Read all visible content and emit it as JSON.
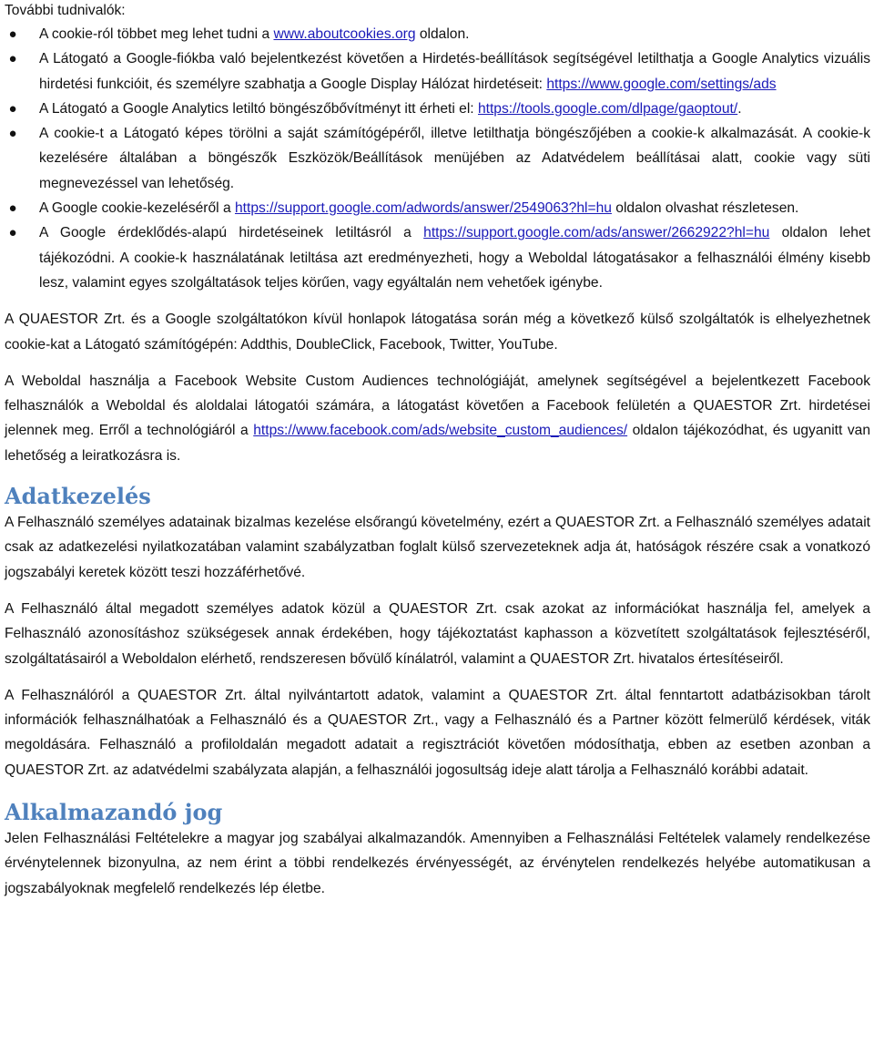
{
  "intro_label": "További tudnivalók:",
  "bullets": [
    {
      "pre": "A cookie-ról többet meg lehet tudni a ",
      "link": "www.aboutcookies.org",
      "post": " oldalon."
    },
    {
      "pre": "A Látogató a Google-fiókba való bejelentkezést követően a Hirdetés-beállítások segítségével letilthatja a Google Analytics vizuális hirdetési funkcióit, és személyre szabhatja a Google Display Hálózat hirdetéseit: ",
      "link": "https://www.google.com/settings/ads",
      "post": ""
    },
    {
      "pre": "A Látogató a Google Analytics letiltó böngészőbővítményt itt érheti el: ",
      "link": "https://tools.google.com/dlpage/gaoptout/",
      "post": "."
    },
    {
      "pre": "A cookie-t a Látogató képes törölni a saját számítógépéről, illetve letilthatja böngészőjében a cookie-k alkalmazását. A cookie-k kezelésére általában a böngészők Eszközök/Beállítások menüjében az Adatvédelem beállításai alatt, cookie vagy süti megnevezéssel van lehetőség.",
      "link": "",
      "post": ""
    },
    {
      "pre": "A Google cookie-kezeléséről a ",
      "link": "https://support.google.com/adwords/answer/2549063?hl=hu",
      "post": " oldalon olvashat részletesen."
    },
    {
      "pre": "A Google érdeklődés-alapú hirdetéseinek letiltásról a ",
      "link": "https://support.google.com/ads/answer/2662922?hl=hu",
      "post": " oldalon lehet tájékozódni. A cookie-k használatának letiltása azt eredményezheti, hogy a Weboldal látogatásakor a felhasználói élmény kisebb lesz, valamint egyes szolgáltatások teljes körűen, vagy egyáltalán nem vehetőek igénybe."
    }
  ],
  "para_thirdparty": "A QUAESTOR Zrt. és a Google szolgáltatókon kívül honlapok látogatása során még a következő külső szolgáltatók is elhelyezhetnek cookie-kat a Látogató számítógépén: Addthis, DoubleClick, Facebook, Twitter, YouTube.",
  "para_facebook": {
    "pre": "A Weboldal használja a Facebook Website Custom Audiences technológiáját, amelynek segítségével a bejelentkezett Facebook felhasználók a Weboldal és aloldalai látogatói számára, a látogatást követően a Facebook felületén a QUAESTOR Zrt. hirdetései jelennek meg. Erről a technológiáról a ",
    "link": "https://www.facebook.com/ads/website_custom_audiences/",
    "post": " oldalon tájékozódhat, és ugyanitt van lehetőség a leiratkozásra is."
  },
  "section_adatkezeles": {
    "heading": "Adatkezelés",
    "paragraphs": [
      "A Felhasználó személyes adatainak bizalmas kezelése elsőrangú követelmény, ezért a QUAESTOR Zrt. a Felhasználó személyes adatait csak az adatkezelési nyilatkozatában valamint szabályzatban foglalt külső szervezeteknek adja át, hatóságok részére csak a vonatkozó jogszabályi keretek között teszi hozzáférhetővé.",
      "A Felhasználó által megadott személyes adatok közül a QUAESTOR Zrt. csak azokat az információkat használja fel, amelyek a Felhasználó azonosításhoz szükségesek annak érdekében, hogy tájékoztatást kaphasson a közvetített szolgáltatások fejlesztéséről, szolgáltatásairól a Weboldalon elérhető, rendszeresen bővülő kínálatról, valamint a QUAESTOR Zrt. hivatalos értesítéseiről.",
      "A Felhasználóról a QUAESTOR Zrt. által nyilvántartott adatok, valamint a QUAESTOR Zrt. által fenntartott adatbázisokban tárolt információk felhasználhatóak a Felhasználó és a QUAESTOR Zrt., vagy a Felhasználó és a Partner között felmerülő kérdések, viták megoldására. Felhasználó a profiloldalán megadott adatait a regisztrációt követően módosíthatja, ebben az esetben azonban a QUAESTOR Zrt. az adatvédelmi szabályzata alapján, a felhasználói jogosultság ideje alatt tárolja a Felhasználó korábbi adatait."
    ]
  },
  "section_alkalmazando": {
    "heading": "Alkalmazandó jog",
    "paragraph": "Jelen Felhasználási Feltételekre a magyar jog szabályai alkalmazandók. Amennyiben a Felhasználási Feltételek valamely rendelkezése érvénytelennek bizonyulna, az nem érint a többi rendelkezés érvényességét, az érvénytelen rendelkezés helyébe automatikusan a jogszabályoknak megfelelő rendelkezés lép életbe."
  },
  "colors": {
    "heading": "#4f81bd",
    "link": "#1a1ab8",
    "text": "#111111"
  }
}
